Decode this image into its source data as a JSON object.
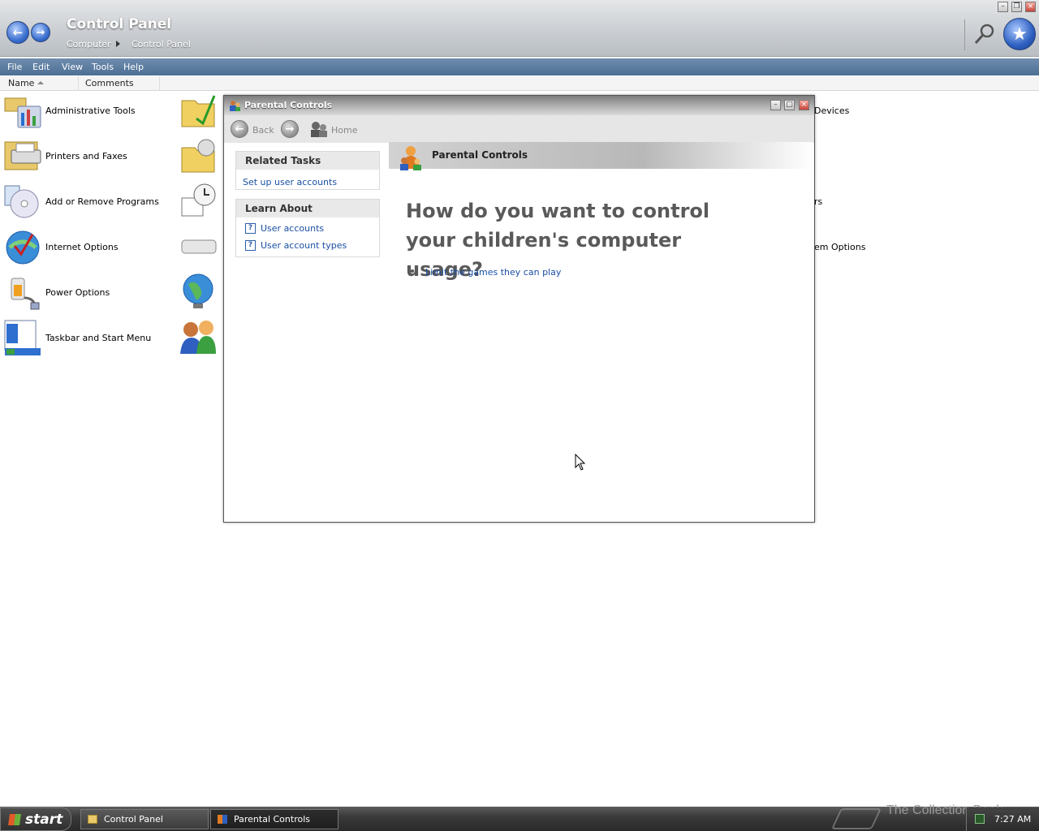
{
  "window": {
    "title": "Control Panel",
    "breadcrumb": [
      "Computer",
      "Control Panel"
    ]
  },
  "menu": [
    "File",
    "Edit",
    "View",
    "Tools",
    "Help"
  ],
  "columns": [
    "Name",
    "Comments"
  ],
  "items_left": [
    {
      "label": "Administrative Tools",
      "icon": "admin-tools-icon"
    },
    {
      "label": "Printers and Faxes",
      "icon": "printer-icon"
    },
    {
      "label": "Add or Remove Programs",
      "icon": "add-remove-programs-icon"
    },
    {
      "label": "Internet Options",
      "icon": "internet-options-icon"
    },
    {
      "label": "Power Options",
      "icon": "power-options-icon"
    },
    {
      "label": "Taskbar and Start Menu",
      "icon": "taskbar-icon"
    }
  ],
  "items_right_partial": [
    "Devices",
    "rs",
    "em Options"
  ],
  "dialog": {
    "title": "Parental Controls",
    "nav": {
      "back": "Back",
      "home": "Home"
    },
    "related_tasks": {
      "header": "Related Tasks",
      "links": [
        "Set up user accounts"
      ]
    },
    "learn_about": {
      "header": "Learn About",
      "links": [
        "User accounts",
        "User account types"
      ]
    },
    "banner_title": "Parental Controls",
    "question": "How do you want to control your children's computer usage?",
    "options": [
      "Limit the games they can play"
    ]
  },
  "taskbar": {
    "start": "start",
    "buttons": [
      "Control Panel",
      "Parental Controls"
    ],
    "clock": "7:27 AM",
    "watermark": "The Collection Book"
  }
}
